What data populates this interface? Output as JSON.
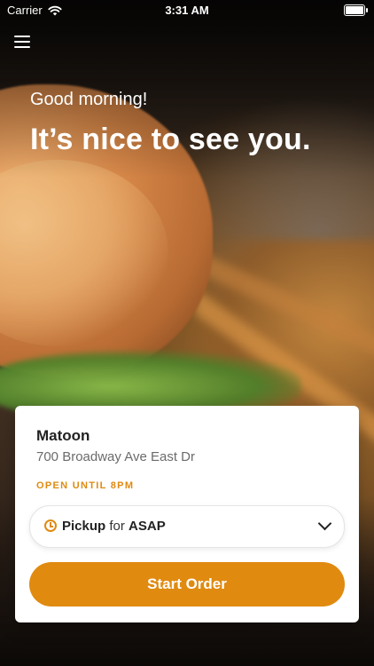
{
  "status_bar": {
    "carrier": "Carrier",
    "time": "3:31 AM",
    "wifi_icon": "wifi-icon",
    "battery_level": 1.0
  },
  "header": {
    "menu_icon": "hamburger-menu-icon",
    "greeting": "Good morning!",
    "headline": "It’s nice to see you."
  },
  "store_card": {
    "name": "Matoon",
    "address": "700 Broadway Ave East Dr",
    "hours": "OPEN UNTIL 8PM",
    "pickup": {
      "mode": "Pickup",
      "connector": "for",
      "time": "ASAP",
      "icon": "clock-icon",
      "dropdown_icon": "chevron-down-icon"
    },
    "start_button": "Start Order"
  },
  "colors": {
    "accent": "#E08A10",
    "card_bg": "#FFFFFF",
    "text_dark": "#222222",
    "text_muted": "#6B6B6B"
  }
}
